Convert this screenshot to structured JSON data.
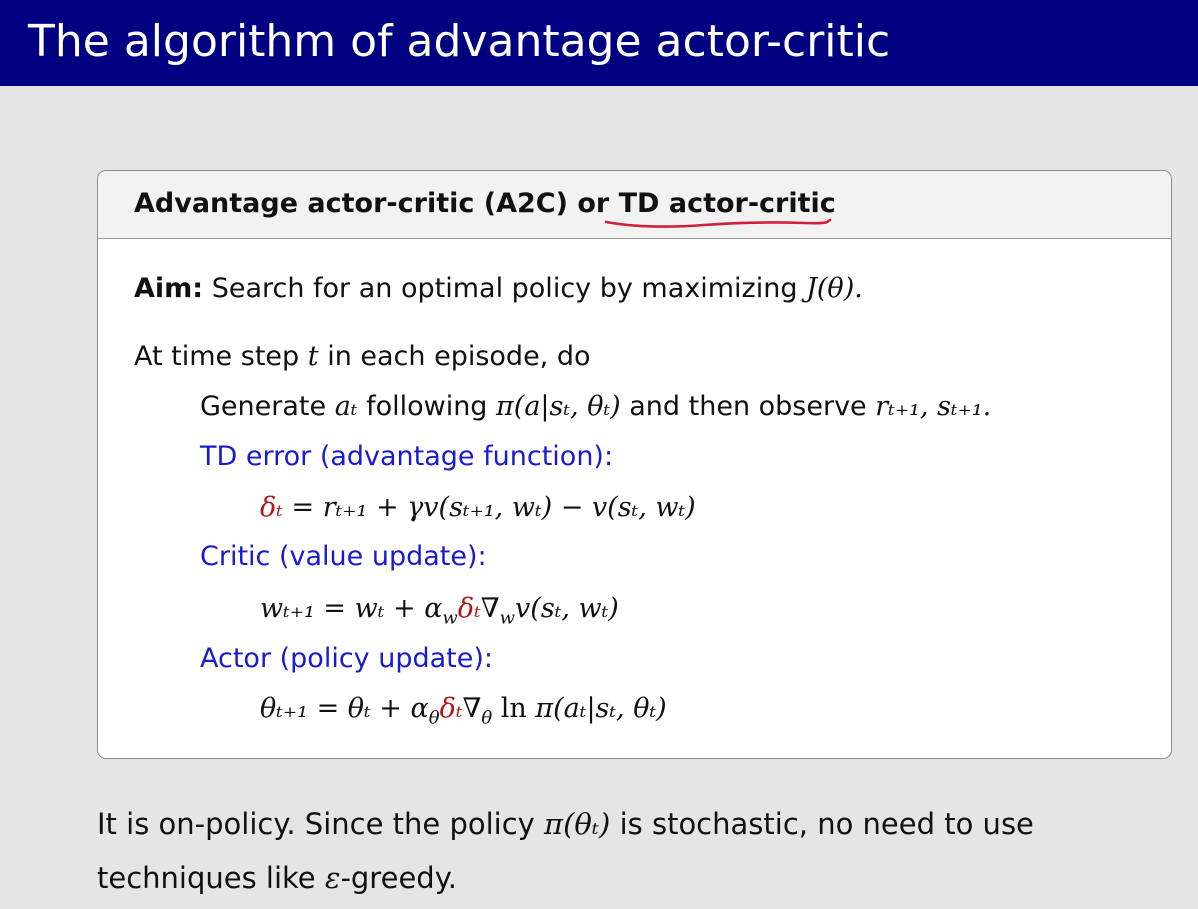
{
  "slide": {
    "title": "The algorithm of advantage actor-critic"
  },
  "block": {
    "title": "Advantage actor-critic (A2C) or TD actor-critic",
    "aim_label": "Aim:",
    "aim_text": "Search for an optimal policy by maximizing",
    "aim_math": "J(θ).",
    "loop_text_1": "At time step",
    "loop_math": "t",
    "loop_text_2": "in each episode, do",
    "generate_text_1": "Generate",
    "generate_math_1": "aₜ",
    "generate_text_2": "following",
    "generate_math_2": "π(a|sₜ, θₜ)",
    "generate_text_3": "and then observe",
    "generate_math_3": "rₜ₊₁, sₜ₊₁.",
    "td_label": "TD error (advantage function):",
    "td_lhs": "δₜ",
    "td_rhs": "= rₜ₊₁ + γv(sₜ₊₁, wₜ) − v(sₜ, wₜ)",
    "critic_label": "Critic (value update):",
    "critic_eq_1": "wₜ₊₁ = wₜ + α",
    "critic_eq_sub": "w",
    "critic_delta": "δₜ",
    "critic_eq_2": "∇",
    "critic_eq_sub2": "w",
    "critic_eq_3": "v(sₜ, wₜ)",
    "actor_label": "Actor (policy update):",
    "actor_eq_1": "θₜ₊₁ = θₜ + α",
    "actor_eq_sub": "θ",
    "actor_delta": "δₜ",
    "actor_eq_2": "∇",
    "actor_eq_sub2": "θ",
    "actor_ln": "ln",
    "actor_eq_3": "π(aₜ|sₜ, θₜ)"
  },
  "footer": {
    "line1_text_1": "It is on-policy.  Since the policy",
    "line1_math": "π(θₜ)",
    "line1_text_2": "is stochastic, no need to use",
    "line2_text_1": "techniques like",
    "line2_math": "ε",
    "line2_text_2": "-greedy."
  },
  "colors": {
    "header": "#000080",
    "label_blue": "#1a1ad0",
    "delta_red": "#b01818",
    "annotation_red": "#d0203a"
  }
}
